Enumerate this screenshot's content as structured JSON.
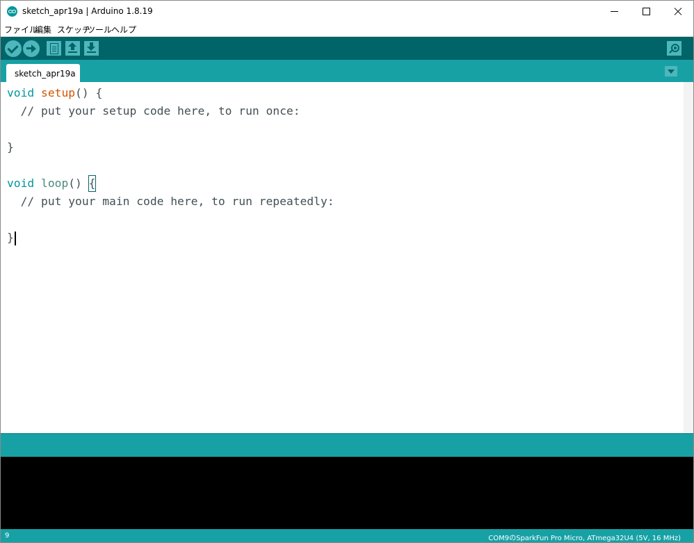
{
  "window": {
    "title": "sketch_apr19a | Arduino 1.8.19"
  },
  "menu": [
    "ファイル",
    "編集",
    "スケッチ",
    "ツール",
    "ヘルプ"
  ],
  "toolbar": {
    "buttons": [
      "verify-icon",
      "upload-icon",
      "new-icon",
      "open-icon",
      "save-icon",
      "serial-monitor-icon"
    ]
  },
  "tabs": [
    {
      "label": "sketch_apr19a"
    }
  ],
  "editor": {
    "setup_kw": "void",
    "setup_fn": "setup",
    "setup_rest": "() {",
    "setup_comment": "  // put your setup code here, to run once:",
    "close1": "}",
    "loop_kw": "void",
    "loop_fn": "loop",
    "loop_paren": "()",
    "loop_brace": "{",
    "loop_comment": "  // put your main code here, to run repeatedly:",
    "close2": "}"
  },
  "status": {
    "line_number": "9",
    "board": "COM9のSparkFun Pro Micro, ATmega32U4 (5V, 16 MHz)"
  },
  "colors": {
    "toolbar": "#006468",
    "tabbar": "#17a1a5",
    "button": "#4db7bb",
    "keyword": "#00979c",
    "function": "#d35400",
    "console": "#000000"
  }
}
